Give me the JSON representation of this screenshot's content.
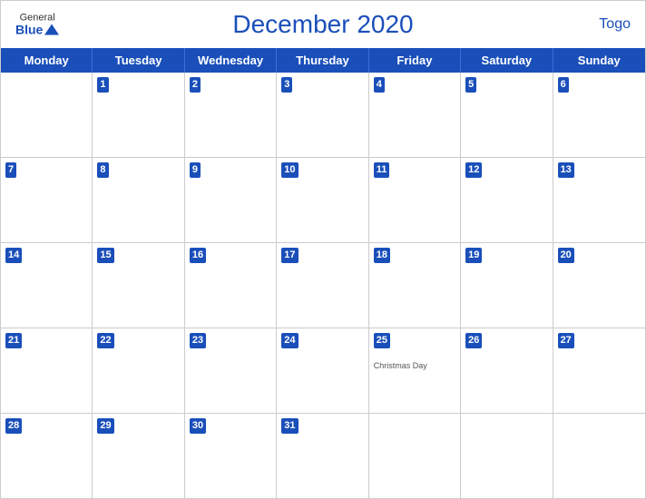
{
  "header": {
    "title": "December 2020",
    "country": "Togo",
    "logo": {
      "general": "General",
      "blue": "Blue"
    }
  },
  "day_headers": [
    "Monday",
    "Tuesday",
    "Wednesday",
    "Thursday",
    "Friday",
    "Saturday",
    "Sunday"
  ],
  "weeks": [
    [
      {
        "day": "",
        "empty": true
      },
      {
        "day": "1"
      },
      {
        "day": "2"
      },
      {
        "day": "3"
      },
      {
        "day": "4"
      },
      {
        "day": "5"
      },
      {
        "day": "6"
      }
    ],
    [
      {
        "day": "7"
      },
      {
        "day": "8"
      },
      {
        "day": "9"
      },
      {
        "day": "10"
      },
      {
        "day": "11"
      },
      {
        "day": "12"
      },
      {
        "day": "13"
      }
    ],
    [
      {
        "day": "14"
      },
      {
        "day": "15"
      },
      {
        "day": "16"
      },
      {
        "day": "17"
      },
      {
        "day": "18"
      },
      {
        "day": "19"
      },
      {
        "day": "20"
      }
    ],
    [
      {
        "day": "21"
      },
      {
        "day": "22"
      },
      {
        "day": "23"
      },
      {
        "day": "24"
      },
      {
        "day": "25",
        "event": "Christmas Day"
      },
      {
        "day": "26"
      },
      {
        "day": "27"
      }
    ],
    [
      {
        "day": "28"
      },
      {
        "day": "29"
      },
      {
        "day": "30"
      },
      {
        "day": "31"
      },
      {
        "day": "",
        "empty": true
      },
      {
        "day": "",
        "empty": true
      },
      {
        "day": "",
        "empty": true
      }
    ]
  ]
}
